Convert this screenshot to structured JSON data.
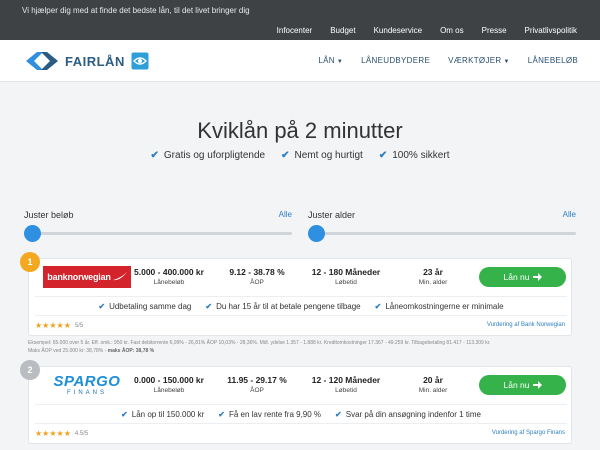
{
  "topbar": {
    "tagline": "Vi hjælper dig med at finde det bedste lån, til det livet bringer dig",
    "links": [
      "Infocenter",
      "Budget",
      "Kundeservice",
      "Om os",
      "Presse",
      "Privatlivspolitik"
    ]
  },
  "brand": {
    "name": "FAIRLÅN",
    "icon": "fairlan-arrows-logo",
    "eye_icon": "eye-icon"
  },
  "nav": [
    {
      "label": "LÅN",
      "dropdown": true
    },
    {
      "label": "LÅNEUDBYDERE",
      "dropdown": false
    },
    {
      "label": "VÆRKTØJER",
      "dropdown": true
    },
    {
      "label": "LÅNEBELØB",
      "dropdown": false
    }
  ],
  "hero": {
    "title": "Kviklån på 2 minutter",
    "features": [
      "Gratis og uforpligtende",
      "Nemt og hurtigt",
      "100% sikkert"
    ]
  },
  "filters": {
    "amount": {
      "label": "Juster beløb",
      "value_label": "Alle",
      "position": 0
    },
    "age": {
      "label": "Juster alder",
      "value_label": "Alle",
      "position": 0
    }
  },
  "offers": [
    {
      "rank": "1",
      "rank_color": "#f3a81f",
      "lender": "banknorwegian",
      "amount": "5.000 - 400.000 kr",
      "amount_label": "Lånebeløb",
      "aop": "9.12 - 38.78 %",
      "aop_label": "ÅOP",
      "term": "12 - 180 Måneder",
      "term_label": "Løbetid",
      "age": "23 år",
      "age_label": "Min. alder",
      "cta": "Lån nu",
      "benefits": [
        "Udbetaling samme dag",
        "Du har 15 år til at betale pengene tilbage",
        "Låneomkostningerne er minimale"
      ],
      "stars": "★★★★★",
      "rating": "5/5",
      "review": "Vurdering af Bank Norwegian",
      "disclaimer": "Eksempel: 65.000 over 5 år. Eff. omk.: 950 kr. Fast debitorrente 6,99% - 26,81% ÅOP 10,03% - 28,36%. Mdl. ydelse 1.357 - 1.888 kr. Kreditomkostninger 17.367 - 49.259 kr. Tilbagebetaling 81.417 - 113.309 kr.",
      "disclaimer2": "Maks ÅOP ved 25.000 kr: 38,78% -",
      "disclaimer2_bold": "maks ÅOP: 38,78 %"
    },
    {
      "rank": "2",
      "rank_color": "#b9bcc0",
      "lender": "SPARGO",
      "lender_sub": "FINANS",
      "amount": "0.000 - 150.000 kr",
      "amount_label": "Lånebeløb",
      "aop": "11.95 - 29.17 %",
      "aop_label": "ÅOP",
      "term": "12 - 120 Måneder",
      "term_label": "Løbetid",
      "age": "20 år",
      "age_label": "Min. alder",
      "cta": "Lån nu",
      "benefits": [
        "Lån op til 150.000 kr",
        "Få en lav rente fra 9,90 %",
        "Svar på din ansøgning indenfor 1 time"
      ],
      "stars": "★★★★★",
      "rating": "4.5/5",
      "review": "Vurdering af Spargo Finans"
    }
  ],
  "colors": {
    "accent": "#2f8fe0",
    "cta": "#36b24a",
    "topbar": "#3f4245",
    "brand": "#2b5d84"
  }
}
